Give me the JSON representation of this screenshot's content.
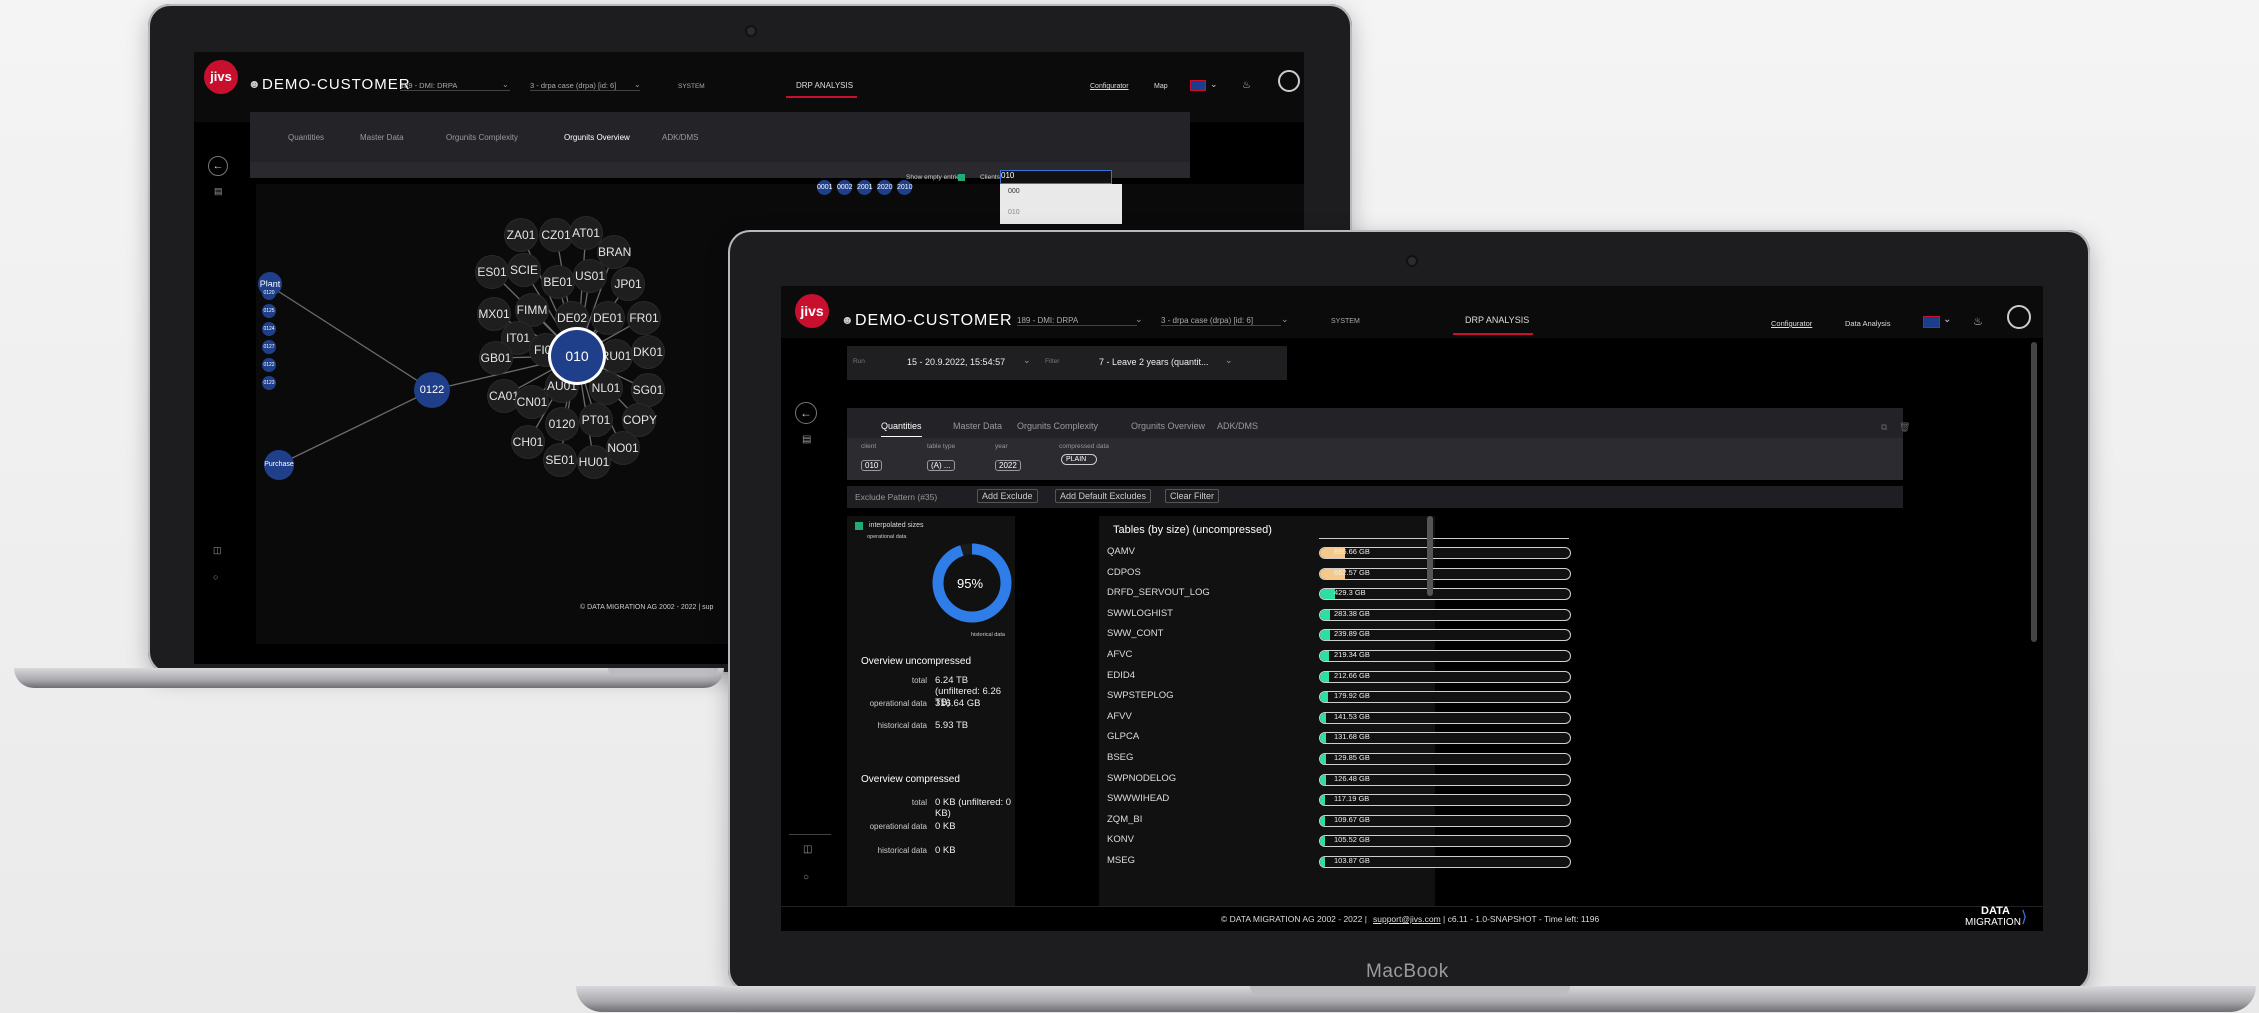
{
  "brand_label": "MacBook",
  "back_app": {
    "logo": "jivs",
    "customer": "DEMO-CUSTOMER",
    "system_select": "189 - DMI: DRPA",
    "case_select": "3 - drpa case (drpa) [id: 6]",
    "system_tab": "SYSTEM",
    "drp_tab": "DRP ANALYSIS",
    "configurator": "Configurator",
    "map": "Map",
    "tabs": [
      "Quantities",
      "Master Data",
      "Orgunits Complexity",
      "Orgunits Overview",
      "ADK/DMS"
    ],
    "show_empty": "Show empty entries",
    "clients_label": "Clients",
    "client_value": "010",
    "dropdown_options": [
      "000",
      "010"
    ],
    "top_nodes": [
      "0001",
      "0002",
      "2001",
      "2020",
      "2010"
    ],
    "center_node": "010",
    "orgunit_nodes": [
      "ZA01",
      "CZ01",
      "AT01",
      "BRAN",
      "ES01",
      "SCIE",
      "BE01",
      "US01",
      "JP01",
      "MX01",
      "FIMM",
      "DE02",
      "DE01",
      "FR01",
      "IT01",
      "GB01",
      "FI01",
      "RU01",
      "DK01",
      "CA01",
      "AU01",
      "NL01",
      "SG01",
      "CN01",
      "0120",
      "PT01",
      "COPY",
      "CH01",
      "NO01",
      "SE01",
      "HU01"
    ],
    "hub_node": "0122",
    "plant_label": "Plant",
    "plant_items": [
      "0120",
      "0125",
      "0124",
      "0127",
      "0122",
      "0123"
    ],
    "purchase_label": "Purchase",
    "footer": "© DATA MIGRATION AG 2002 - 2022 | sup"
  },
  "front_app": {
    "logo": "jivs",
    "customer": "DEMO-CUSTOMER",
    "system_select": "189 - DMI: DRPA",
    "case_select": "3 - drpa case (drpa) [id: 6]",
    "system_tab": "SYSTEM",
    "drp_tab": "DRP ANALYSIS",
    "configurator": "Configurator",
    "data_analysis": "Data Analysis",
    "run_label": "Run",
    "run_value": "15 - 20.9.2022, 15:54:57",
    "filter_label": "Filter",
    "filter_value": "7 - Leave 2 years (quantit...",
    "tabs": [
      "Quantities",
      "Master Data",
      "Orgunits Complexity",
      "Orgunits Overview",
      "ADK/DMS"
    ],
    "filters": {
      "client_label": "client",
      "client_chip": "010",
      "table_type_label": "table type",
      "table_type_chip": "(A) ...",
      "year_label": "year",
      "year_chip": "2022",
      "compressed_label": "compressed data",
      "compressed_toggle": "PLAIN"
    },
    "exclude_placeholder": "Exclude Pattern (#35)",
    "add_exclude": "Add Exclude",
    "add_default_excludes": "Add Default Excludes",
    "clear_filter": "Clear Filter",
    "interpolated_label": "interpolated sizes",
    "donut": {
      "operational_label": "operational data",
      "historical_label": "historical data",
      "percent": "95%",
      "fraction": 0.95
    },
    "overview_uncompressed": {
      "title": "Overview uncompressed",
      "rows": [
        {
          "label": "total",
          "value": "6.24 TB (unfiltered: 6.26 TB)"
        },
        {
          "label": "operational data",
          "value": "316.64 GB"
        },
        {
          "label": "historical data",
          "value": "5.93 TB"
        }
      ]
    },
    "overview_compressed": {
      "title": "Overview compressed",
      "rows": [
        {
          "label": "total",
          "value": "0 KB (unfiltered: 0 KB)"
        },
        {
          "label": "operational data",
          "value": "0 KB"
        },
        {
          "label": "historical data",
          "value": "0 KB"
        }
      ]
    },
    "tables_title": "Tables (by size) (uncompressed)",
    "tables": [
      {
        "name": "QAMV",
        "size": "695.66 GB",
        "fill": 0.1,
        "color": "#f5c98a"
      },
      {
        "name": "CDPOS",
        "size": "662.57 GB",
        "fill": 0.1,
        "color": "#f5c98a"
      },
      {
        "name": "DRFD_SERVOUT_LOG",
        "size": "429.3 GB",
        "fill": 0.06,
        "color": "#2de0a0"
      },
      {
        "name": "SWWLOGHIST",
        "size": "283.38 GB",
        "fill": 0.04,
        "color": "#2de0a0"
      },
      {
        "name": "SWW_CONT",
        "size": "239.89 GB",
        "fill": 0.04,
        "color": "#2de0a0"
      },
      {
        "name": "AFVC",
        "size": "219.34 GB",
        "fill": 0.035,
        "color": "#2de0a0"
      },
      {
        "name": "EDID4",
        "size": "212.66 GB",
        "fill": 0.035,
        "color": "#2de0a0"
      },
      {
        "name": "SWPSTEPLOG",
        "size": "179.92 GB",
        "fill": 0.03,
        "color": "#2de0a0"
      },
      {
        "name": "AFVV",
        "size": "141.53 GB",
        "fill": 0.025,
        "color": "#2de0a0"
      },
      {
        "name": "GLPCA",
        "size": "131.68 GB",
        "fill": 0.025,
        "color": "#2de0a0"
      },
      {
        "name": "BSEG",
        "size": "129.85 GB",
        "fill": 0.025,
        "color": "#2de0a0"
      },
      {
        "name": "SWPNODELOG",
        "size": "126.48 GB",
        "fill": 0.025,
        "color": "#2de0a0"
      },
      {
        "name": "SWWWIHEAD",
        "size": "117.19 GB",
        "fill": 0.02,
        "color": "#2de0a0"
      },
      {
        "name": "ZQM_BI",
        "size": "109.67 GB",
        "fill": 0.02,
        "color": "#2de0a0"
      },
      {
        "name": "KONV",
        "size": "105.52 GB",
        "fill": 0.02,
        "color": "#2de0a0"
      },
      {
        "name": "MSEG",
        "size": "103.87 GB",
        "fill": 0.02,
        "color": "#2de0a0"
      }
    ],
    "footer_text": "© DATA MIGRATION AG 2002 - 2022 |",
    "footer_link": "support@jivs.com",
    "footer_version": "| c6.11 - 1.0-SNAPSHOT - Time left: 1196",
    "corner_logo_top": "DATA",
    "corner_logo_bottom": "MIGRATION"
  }
}
